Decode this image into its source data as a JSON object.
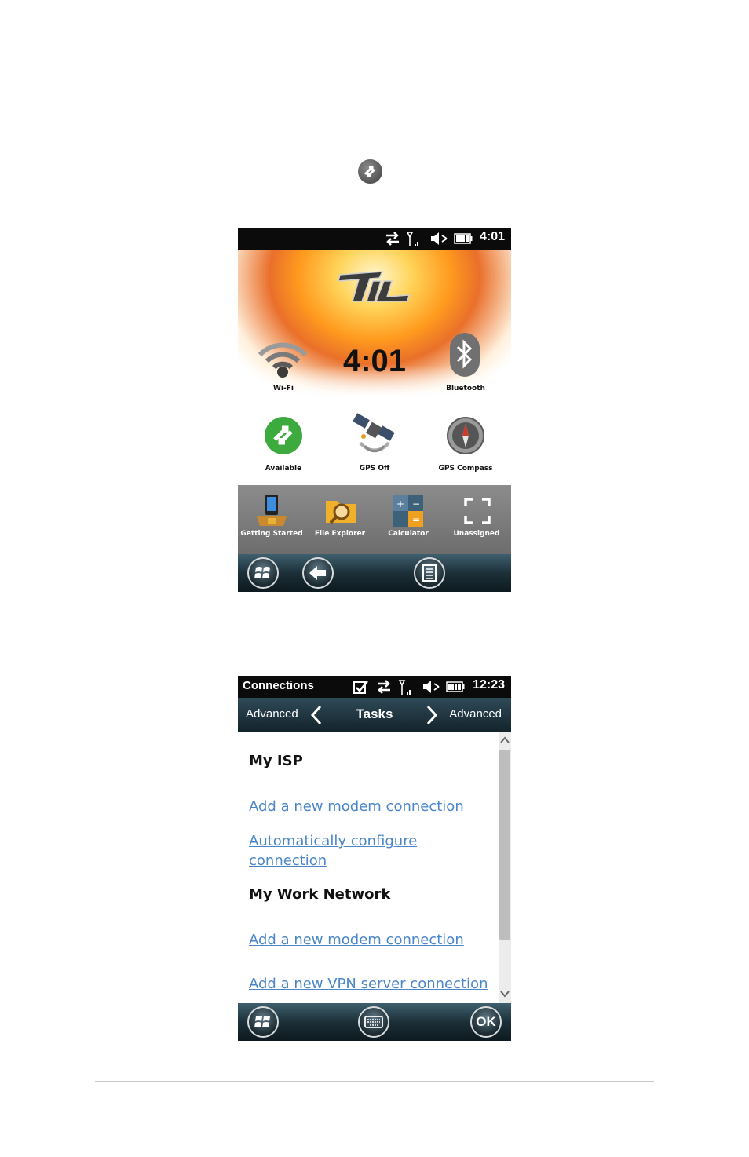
{
  "today": {
    "status_time": "4:01",
    "clock": "4:01",
    "tiles": [
      {
        "label": "Wi-Fi",
        "icon": "wifi-icon"
      },
      {
        "label": "Bluetooth",
        "icon": "bluetooth-icon"
      },
      {
        "label": "Available",
        "icon": "sync-available-icon"
      },
      {
        "label": "GPS Off",
        "icon": "satellite-icon"
      },
      {
        "label": "GPS Compass",
        "icon": "compass-icon"
      }
    ],
    "quick_apps": [
      {
        "label": "Getting Started",
        "icon": "getting-started-icon"
      },
      {
        "label": "File Explorer",
        "icon": "file-explorer-icon"
      },
      {
        "label": "Calculator",
        "icon": "calculator-icon"
      },
      {
        "label": "Unassigned",
        "icon": "unassigned-icon"
      }
    ],
    "taskbar_icons": [
      "windows-start-icon",
      "back-arrow-icon",
      "menu-icon"
    ]
  },
  "connections": {
    "status_title": "Connections",
    "status_time": "12:23",
    "nav": {
      "left": "Advanced",
      "center": "Tasks",
      "right": "Advanced"
    },
    "sections": [
      {
        "title": "My ISP",
        "links": [
          "Add a new modem connection",
          "Automatically configure connection"
        ]
      },
      {
        "title": "My Work Network",
        "links": [
          "Add a new modem connection",
          "Add a new VPN server connection"
        ]
      }
    ],
    "ok_label": "OK",
    "taskbar_icons": [
      "windows-start-icon",
      "keyboard-icon"
    ]
  },
  "colors": {
    "link": "#4a86c8",
    "taskbar": "#1c2f38",
    "hero_orange": "#ff9a1e"
  }
}
